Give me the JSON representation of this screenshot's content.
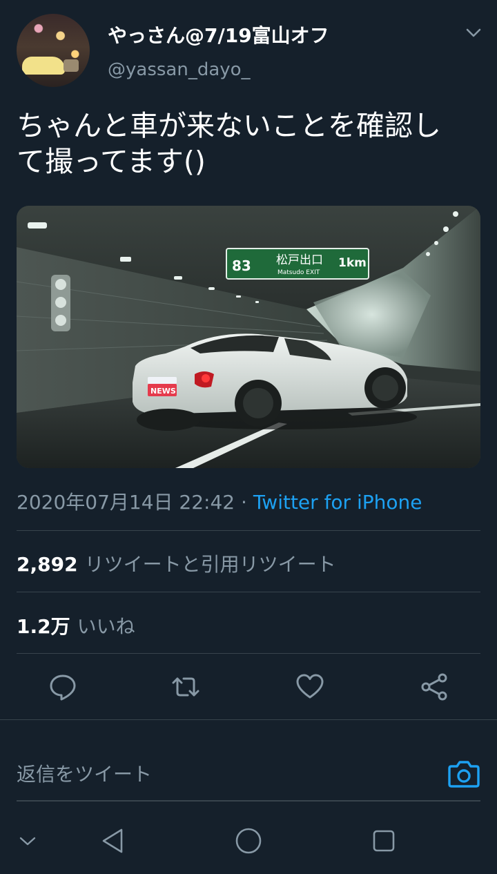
{
  "tweet": {
    "display_name": "やっさん@7/19富山オフ",
    "handle": "@yassan_dayo_",
    "text_line1": "ちゃんと車が来ないことを確認し",
    "text_line2": "て撮ってます()",
    "timestamp": "2020年07月14日 22:42",
    "separator": "·",
    "source": "Twitter for iPhone"
  },
  "media": {
    "sign_route": "83",
    "sign_jp": "松戸出口",
    "sign_en": "Matsudo EXIT",
    "sign_distance": "1km",
    "plate_text": "NEWS"
  },
  "stats": {
    "retweets_count": "2,892",
    "retweets_label": "リツイートと引用リツイート",
    "likes_count": "1.2万",
    "likes_label": "いいね"
  },
  "reply": {
    "placeholder": "返信をツイート"
  },
  "icons": {
    "more": "chevron-down-icon",
    "reply": "reply-icon",
    "retweet": "retweet-icon",
    "like": "heart-icon",
    "share": "share-icon",
    "camera": "camera-icon",
    "nav_hide": "chevron-down-icon",
    "nav_back": "back-triangle-icon",
    "nav_home": "home-circle-icon",
    "nav_recents": "recents-square-icon"
  },
  "colors": {
    "background": "#15202b",
    "accent": "#1da1f2",
    "secondary_text": "#8899a6",
    "divider": "#38444d"
  }
}
